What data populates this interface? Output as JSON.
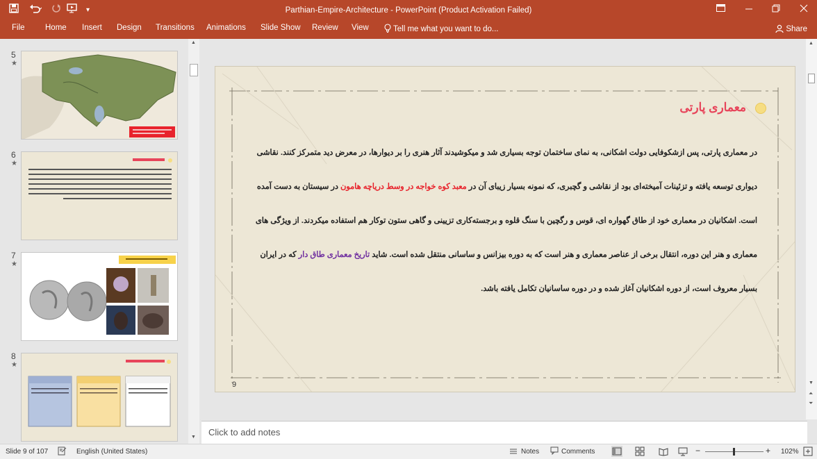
{
  "window": {
    "title": "Parthian-Empire-Architecture - PowerPoint (Product Activation Failed)"
  },
  "ribbon": {
    "tabs": [
      "File",
      "Home",
      "Insert",
      "Design",
      "Transitions",
      "Animations",
      "Slide Show",
      "Review",
      "View"
    ],
    "tell_me": "Tell me what you want to do...",
    "share": "Share"
  },
  "thumbnails": [
    {
      "num": "5",
      "star": "★"
    },
    {
      "num": "6",
      "star": "★"
    },
    {
      "num": "7",
      "star": "★"
    },
    {
      "num": "8",
      "star": "★"
    }
  ],
  "slide": {
    "title": "معماری پارتی",
    "page_number": "9",
    "body": {
      "seg1": "در معماری پارتی، پس ازشکوفایی دولت اشکانی، به نمای ساختمان توجه بسیاری شد و میکوشیدند آثار هنری را بر دیوارها، در معرض دید متمرکز کنند. نقاشی دیواری توسعه یافته و تزئینات آمیخته‌ای بود از نقاشی و گچبری، که نمونه بسیار زیبای آن در ",
      "red": "معبد کوه خواجه در وسط دریاچه هامون",
      "seg2": " در سیستان به دست آمده است. اشکانیان در معماری خود از طاق گهواره ای، قوس و رگچین با سنگ قلوه و برجسته‌کاری تزیینی و گاهی ستون توکار هم استفاده میکردند. از ویژگی های معماری و هنر این دوره، انتقال برخی از عناصر معماری و هنر است که به دوره بیزانس و ساسانی منتقل شده است. شاید ",
      "purple": "تاریخ معماری طاق دار",
      "seg3": " که در ایران بسیار معروف است، از دوره اشکانیان آغاز شده و در دوره ساسانیان تکامل یافته باشد."
    }
  },
  "notes": {
    "placeholder": "Click to add notes"
  },
  "status": {
    "slide": "Slide 9 of 107",
    "language": "English (United States)",
    "notes": "Notes",
    "comments": "Comments",
    "zoom": "102%"
  },
  "colors": {
    "accent": "#b7472a",
    "title_red": "#e7445a",
    "highlight_red": "#e8232c",
    "highlight_purple": "#7030a0"
  }
}
